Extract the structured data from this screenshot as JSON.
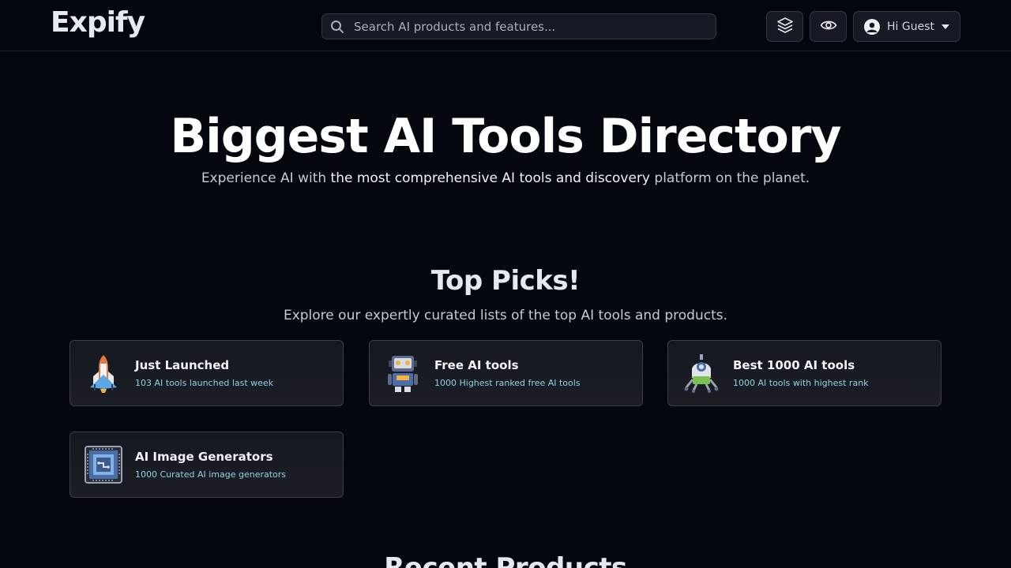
{
  "header": {
    "logo": "Expify",
    "search_placeholder": "Search AI products and features...",
    "layers_icon": "layers-icon",
    "eye_icon": "eye-icon",
    "user_label": "Hi Guest"
  },
  "hero": {
    "title": "Biggest AI Tools Directory",
    "subtitle_pre": "Experience AI with ",
    "subtitle_strong": "the most comprehensive AI tools and discovery",
    "subtitle_post": " platform on the planet."
  },
  "top_picks": {
    "title": "Top Picks!",
    "subtitle": "Explore our expertly curated lists of the top AI tools and products.",
    "cards": [
      {
        "title": "Just Launched",
        "desc": "103 AI tools launched last week",
        "icon": "rocket-icon"
      },
      {
        "title": "Free AI tools",
        "desc": "1000 Highest ranked free AI tools",
        "icon": "robot-icon"
      },
      {
        "title": "Best 1000 AI tools",
        "desc": "1000 AI tools with highest rank",
        "icon": "rover-robot-icon"
      },
      {
        "title": "AI Image Generators",
        "desc": "1000 Curated AI image generators",
        "icon": "chip-icon"
      }
    ]
  },
  "recent": {
    "title": "Recent Products"
  },
  "colors": {
    "background": "#05070f",
    "accent_desc": "#8fd0e8"
  }
}
